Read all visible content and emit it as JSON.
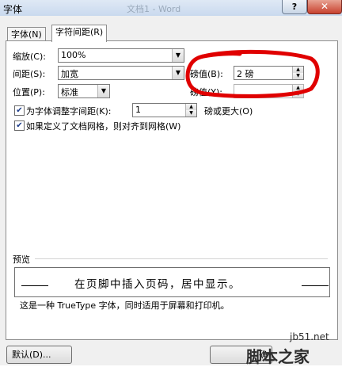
{
  "window": {
    "title": "字体",
    "title_blurred": "文档1 - Word",
    "help_label": "?",
    "close_label": "✕"
  },
  "tabs": [
    {
      "label": "字体(N)",
      "active": false
    },
    {
      "label": "字符间距(R)",
      "active": true
    }
  ],
  "fields": {
    "scale": {
      "label": "缩放(C):",
      "value": "100%"
    },
    "spacing": {
      "label": "间距(S):",
      "value": "加宽",
      "by_label": "磅值(B):",
      "by_value": "2 磅"
    },
    "position": {
      "label": "位置(P):",
      "value": "标准",
      "by_label": "磅值(Y):",
      "by_value": ""
    },
    "kerning": {
      "label": "为字体调整字间距(K):",
      "checked": true,
      "value": "1",
      "suffix": "磅或更大(O)"
    },
    "snap_grid": {
      "label": "如果定义了文档网格，则对齐到网格(W)",
      "checked": true
    }
  },
  "preview": {
    "label": "预览",
    "sample_text": "在页脚中插入页码，居中显示。",
    "note": "这是一种 TrueType 字体，同时适用于屏幕和打印机。"
  },
  "buttons": {
    "default": "默认(D)...",
    "ok": "确"
  },
  "annotation_color": "#e00000",
  "watermark": {
    "line1": "jb51.net",
    "line2": "脚本之家"
  }
}
